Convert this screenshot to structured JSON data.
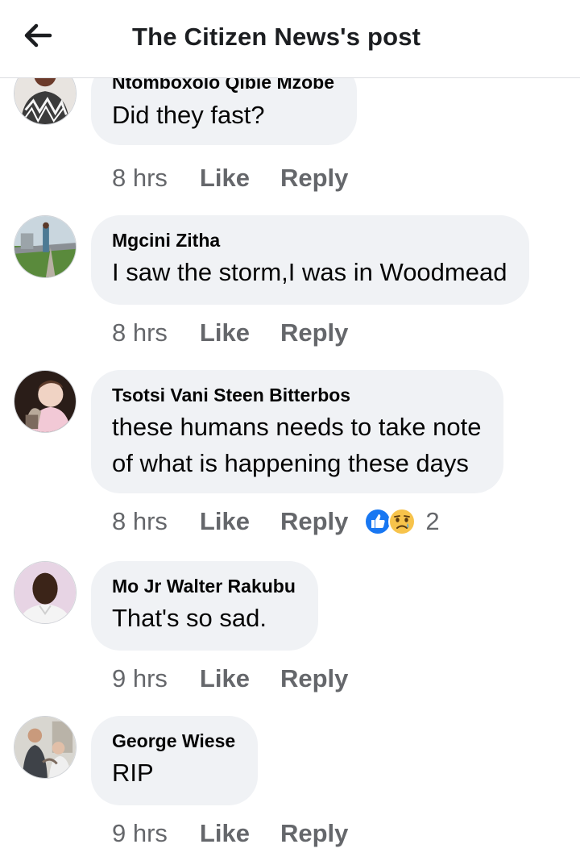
{
  "header": {
    "title": "The Citizen News's post",
    "back_icon": "arrow-left-icon"
  },
  "colors": {
    "bubble_bg": "#f0f2f5",
    "meta_text": "#65676b",
    "like_blue": "#1877f2",
    "sad_yellow": "#f7c34b"
  },
  "comments": [
    {
      "author": "Ntomboxolo Qibie Mzobe",
      "lines": [
        "Did they fast?"
      ],
      "time": "8 hrs",
      "like": "Like",
      "reply": "Reply"
    },
    {
      "author": "Mgcini Zitha",
      "lines": [
        "I saw the storm,I was in Woodmead"
      ],
      "time": "8 hrs",
      "like": "Like",
      "reply": "Reply"
    },
    {
      "author": "Tsotsi Vani Steen Bitterbos",
      "lines": [
        "these humans needs to take note",
        "of what is happening these days"
      ],
      "time": "8 hrs",
      "like": "Like",
      "reply": "Reply",
      "reactions": {
        "icons": [
          "like-reaction-icon",
          "sad-reaction-icon"
        ],
        "count": "2"
      }
    },
    {
      "author": "Mo Jr Walter Rakubu",
      "lines": [
        "That's so sad."
      ],
      "time": "9 hrs",
      "like": "Like",
      "reply": "Reply"
    },
    {
      "author": "George Wiese",
      "lines": [
        "RIP"
      ],
      "time": "9 hrs",
      "like": "Like",
      "reply": "Reply"
    }
  ]
}
